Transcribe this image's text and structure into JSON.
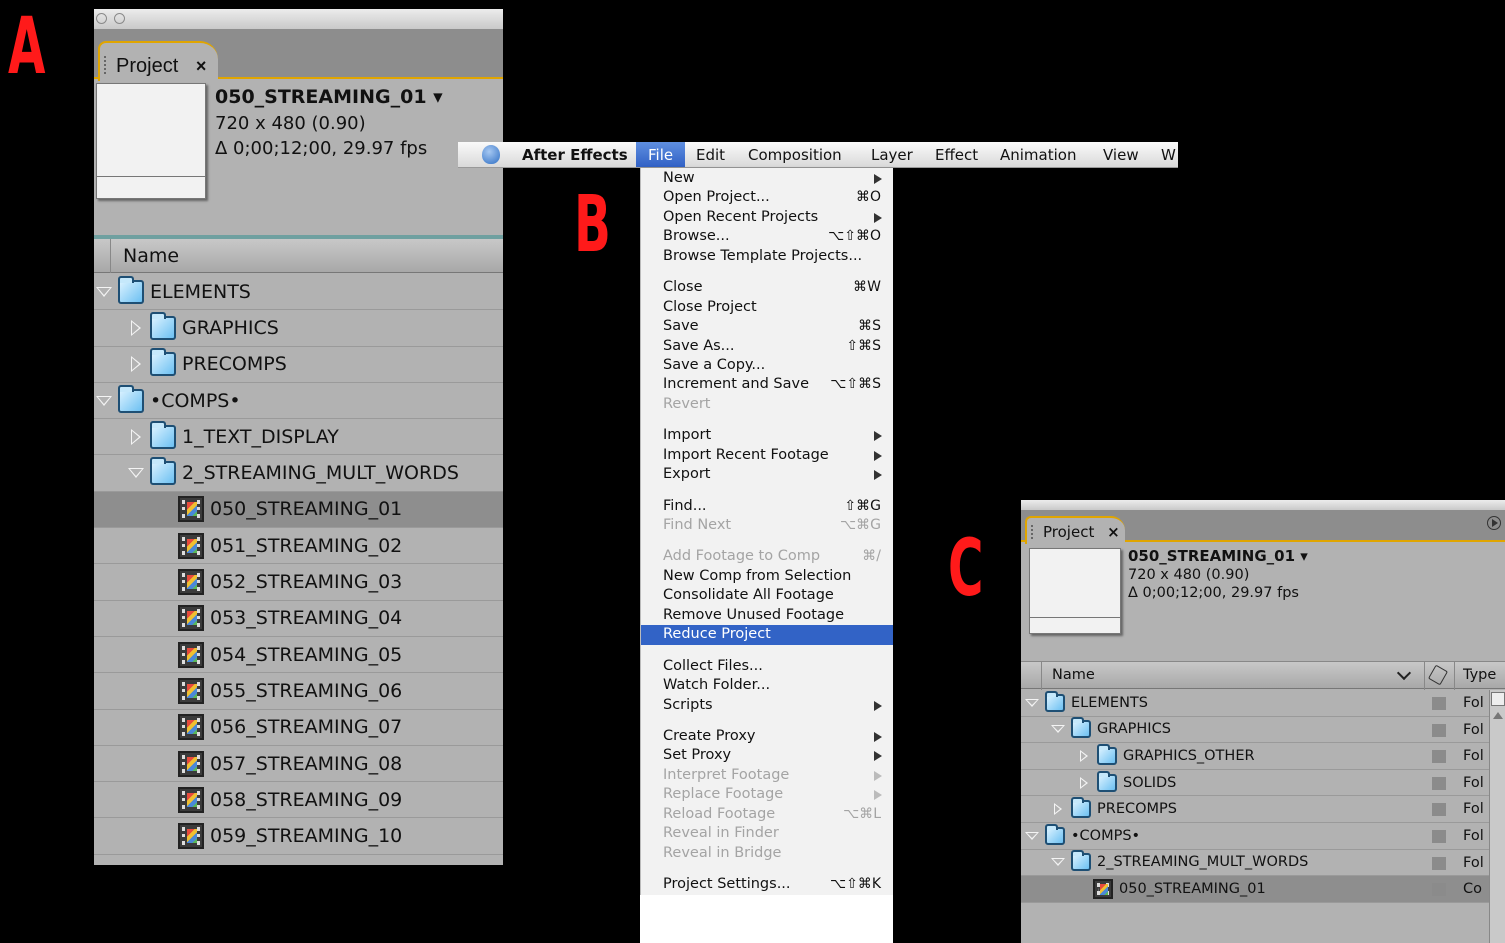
{
  "labels": {
    "a": "A",
    "b": "B",
    "c": "C"
  },
  "panel_a": {
    "tab_label": "Project",
    "tab_close": "×",
    "comp_name": "050_STREAMING_01 ▾",
    "comp_size": "720 x 480 (0.90)",
    "comp_duration": "Δ 0;00;12;00, 29.97 fps",
    "column_name": "Name",
    "rows": [
      {
        "label": "ELEMENTS",
        "level": 0,
        "twirl": "down",
        "icon": "folder"
      },
      {
        "label": "GRAPHICS",
        "level": 1,
        "twirl": "right",
        "icon": "folder"
      },
      {
        "label": "PRECOMPS",
        "level": 1,
        "twirl": "right",
        "icon": "folder"
      },
      {
        "label": "•COMPS•",
        "level": 0,
        "twirl": "down",
        "icon": "folder"
      },
      {
        "label": "1_TEXT_DISPLAY",
        "level": 1,
        "twirl": "right",
        "icon": "folder"
      },
      {
        "label": "2_STREAMING_MULT_WORDS",
        "level": 1,
        "twirl": "down",
        "icon": "folder"
      },
      {
        "label": "050_STREAMING_01",
        "level": 2,
        "twirl": "none",
        "icon": "comp",
        "selected": true
      },
      {
        "label": "051_STREAMING_02",
        "level": 2,
        "twirl": "none",
        "icon": "comp"
      },
      {
        "label": "052_STREAMING_03",
        "level": 2,
        "twirl": "none",
        "icon": "comp"
      },
      {
        "label": "053_STREAMING_04",
        "level": 2,
        "twirl": "none",
        "icon": "comp"
      },
      {
        "label": "054_STREAMING_05",
        "level": 2,
        "twirl": "none",
        "icon": "comp"
      },
      {
        "label": "055_STREAMING_06",
        "level": 2,
        "twirl": "none",
        "icon": "comp"
      },
      {
        "label": "056_STREAMING_07",
        "level": 2,
        "twirl": "none",
        "icon": "comp"
      },
      {
        "label": "057_STREAMING_08",
        "level": 2,
        "twirl": "none",
        "icon": "comp"
      },
      {
        "label": "058_STREAMING_09",
        "level": 2,
        "twirl": "none",
        "icon": "comp"
      },
      {
        "label": "059_STREAMING_10",
        "level": 2,
        "twirl": "none",
        "icon": "comp"
      }
    ]
  },
  "menubar": {
    "app_name": "After Effects",
    "items": [
      "File",
      "Edit",
      "Composition",
      "Layer",
      "Effect",
      "Animation",
      "View",
      "W"
    ]
  },
  "file_menu": {
    "groups": [
      [
        {
          "label": "New",
          "submenu": true
        },
        {
          "label": "Open Project...",
          "shortcut": "⌘O"
        },
        {
          "label": "Open Recent Projects",
          "submenu": true
        },
        {
          "label": "Browse...",
          "shortcut": "⌥⇧⌘O"
        },
        {
          "label": "Browse Template Projects..."
        }
      ],
      [
        {
          "label": "Close",
          "shortcut": "⌘W"
        },
        {
          "label": "Close Project"
        },
        {
          "label": "Save",
          "shortcut": "⌘S"
        },
        {
          "label": "Save As...",
          "shortcut": "⇧⌘S"
        },
        {
          "label": "Save a Copy..."
        },
        {
          "label": "Increment and Save",
          "shortcut": "⌥⇧⌘S"
        },
        {
          "label": "Revert",
          "disabled": true
        }
      ],
      [
        {
          "label": "Import",
          "submenu": true
        },
        {
          "label": "Import Recent Footage",
          "submenu": true
        },
        {
          "label": "Export",
          "submenu": true
        }
      ],
      [
        {
          "label": "Find...",
          "shortcut": "⇧⌘G"
        },
        {
          "label": "Find Next",
          "shortcut": "⌥⌘G",
          "disabled": true
        }
      ],
      [
        {
          "label": "Add Footage to Comp",
          "shortcut": "⌘/",
          "disabled": true
        },
        {
          "label": "New Comp from Selection"
        },
        {
          "label": "Consolidate All Footage"
        },
        {
          "label": "Remove Unused Footage"
        },
        {
          "label": "Reduce Project",
          "highlighted": true
        }
      ],
      [
        {
          "label": "Collect Files..."
        },
        {
          "label": "Watch Folder..."
        },
        {
          "label": "Scripts",
          "submenu": true
        }
      ],
      [
        {
          "label": "Create Proxy",
          "submenu": true
        },
        {
          "label": "Set Proxy",
          "submenu": true
        },
        {
          "label": "Interpret Footage",
          "submenu": true,
          "disabled": true
        },
        {
          "label": "Replace Footage",
          "submenu": true,
          "disabled": true
        },
        {
          "label": "Reload Footage",
          "shortcut": "⌥⌘L",
          "disabled": true
        },
        {
          "label": "Reveal in Finder",
          "disabled": true
        },
        {
          "label": "Reveal in Bridge",
          "disabled": true
        }
      ],
      [
        {
          "label": "Project Settings...",
          "shortcut": "⌥⇧⌘K"
        }
      ]
    ]
  },
  "panel_c": {
    "tab_label": "Project",
    "tab_close": "×",
    "comp_name": "050_STREAMING_01 ▾",
    "comp_size": "720 x 480 (0.90)",
    "comp_duration": "Δ 0;00;12;00, 29.97 fps",
    "column_name": "Name",
    "column_type": "Type",
    "rows": [
      {
        "label": "ELEMENTS",
        "level": 0,
        "twirl": "down",
        "icon": "folder",
        "type": "Fol"
      },
      {
        "label": "GRAPHICS",
        "level": 1,
        "twirl": "down",
        "icon": "folder",
        "type": "Fol"
      },
      {
        "label": "GRAPHICS_OTHER",
        "level": 2,
        "twirl": "right",
        "icon": "folder",
        "type": "Fol"
      },
      {
        "label": "SOLIDS",
        "level": 2,
        "twirl": "right",
        "icon": "folder",
        "type": "Fol"
      },
      {
        "label": "PRECOMPS",
        "level": 1,
        "twirl": "right",
        "icon": "folder",
        "type": "Fol"
      },
      {
        "label": "•COMPS•",
        "level": 0,
        "twirl": "down",
        "icon": "folder",
        "type": "Fol"
      },
      {
        "label": "2_STREAMING_MULT_WORDS",
        "level": 1,
        "twirl": "down",
        "icon": "folder",
        "type": "Fol"
      },
      {
        "label": "050_STREAMING_01",
        "level": 2,
        "twirl": "none",
        "icon": "comp",
        "type": "Co",
        "selected": true
      }
    ]
  }
}
